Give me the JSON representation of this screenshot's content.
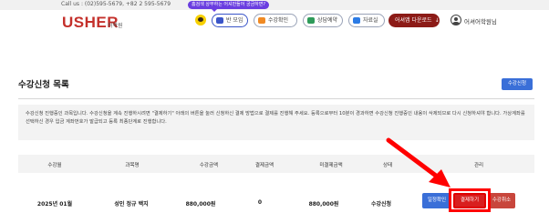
{
  "topbar": {
    "call": "Call us : (02)595-5679, +82 2 595-5679"
  },
  "header": {
    "logo": "USHER",
    "logo_sub": "어학원",
    "tooltip": "홈검색 상부하는 어셔만들어 궁금하면?",
    "nav": [
      {
        "label": "반 모임",
        "icon": "class-icon"
      },
      {
        "label": "수강확인",
        "icon": "pencil-icon"
      },
      {
        "label": "상담예약",
        "icon": "person-icon"
      },
      {
        "label": "자료실",
        "icon": "folder-icon"
      }
    ],
    "download": {
      "label": "어셔앱 다운로드",
      "arrow": "↓"
    },
    "user": "어셔어학원님"
  },
  "page": {
    "title": "수강신청 목록",
    "apply_button": "수강신청",
    "notice": "수강신청 진행중인 과목입니다. 수강신청을 계속 진행하시려면 \"결제하기\" 아래의 버튼을 눌러 신청하신 결제 방법으로 결제를 진행해 주세요. 등록으로부터 10분이 경과하면 수강신청 진행중인 내용이 삭제되므로 다시 신청하셔야 합니다. 가상계좌를 선택하신 경우 입금 계좌번호가 발급되고 등록 최종단계로 진행합니다."
  },
  "table": {
    "headers": [
      "수강월",
      "과목명",
      "수강금액",
      "결제금액",
      "미결제금액",
      "상태",
      "관리"
    ],
    "rows": [
      {
        "month": "2025년 01월",
        "course": "성인 정규 백지",
        "fee": "880,000원",
        "paid": "0",
        "unpaid": "880,000원",
        "status": "수강신청",
        "actions": [
          "일정확인",
          "결제하기",
          "수강취소"
        ]
      }
    ]
  },
  "colors": {
    "brand": "#c4302b",
    "primary": "#3a6fd8",
    "pay": "#d81f1f",
    "highlight": "#ff0000"
  }
}
